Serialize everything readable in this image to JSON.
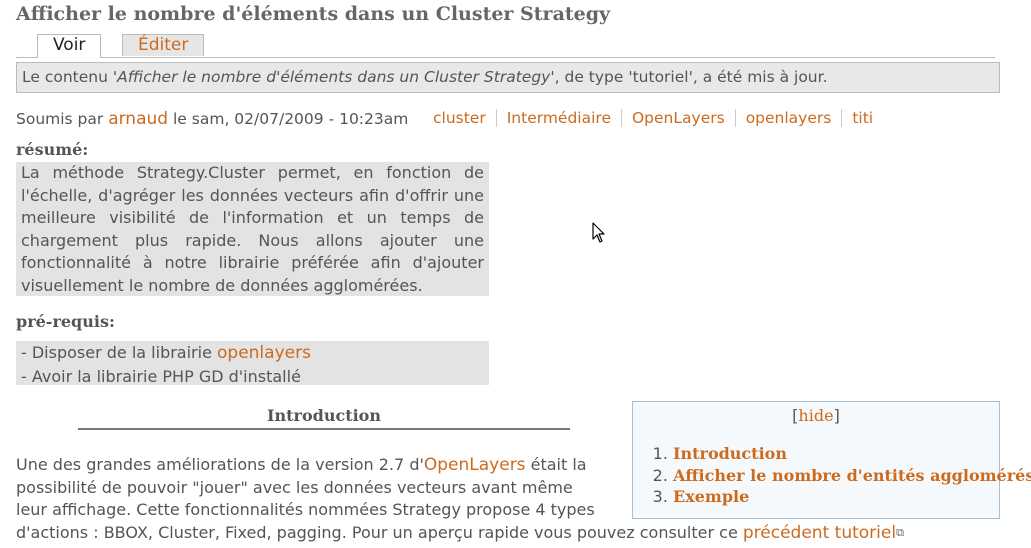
{
  "page": {
    "title": "Afficher le nombre d'éléments dans un Cluster Strategy"
  },
  "tabs": {
    "voir": "Voir",
    "editer": "Éditer"
  },
  "status": {
    "prefix": "Le contenu '",
    "title": "Afficher le nombre d'éléments dans un Cluster Strategy",
    "suffix": "', de type 'tutoriel', a été mis à jour."
  },
  "submitted": {
    "prefix": "Soumis par ",
    "author": "arnaud",
    "date": " le sam, 02/07/2009 - 10:23am"
  },
  "tags": [
    "cluster",
    "Intermédiaire",
    "OpenLayers",
    "openlayers",
    "titi"
  ],
  "resume": {
    "label": "résumé:",
    "text": "La méthode Strategy.Cluster permet, en fonction de l'échelle, d'agréger les données vecteurs afin d'offrir une meilleure visibilité de l'information et un temps de chargement plus rapide. Nous allons ajouter une fonctionnalité à notre librairie préférée afin d'ajouter visuellement le nombre de données agglomérées."
  },
  "prereq": {
    "label": "pré-requis:",
    "line1_prefix": "- Disposer de la librairie ",
    "line1_link": "openlayers",
    "line2": "- Avoir la librairie PHP GD d'installé"
  },
  "intro": {
    "heading": "Introduction"
  },
  "body": {
    "line1_prefix": "Une des grandes améliorations de la version 2.7 d'",
    "line1_link": "OpenLayers",
    "line1_suffix": " était la",
    "line2": "possibilité de pouvoir \"jouer\" avec les données vecteurs avant même",
    "line3": "leur affichage. Cette fonctionnalités nommées Strategy propose 4 types",
    "line4_prefix": "d'actions : BBOX, Cluster, Fixed, pagging. Pour un aperçu rapide vous pouvez consulter ce ",
    "line4_link": "précédent tutoriel"
  },
  "toc": {
    "hide_label": "hide",
    "items": [
      "Introduction",
      "Afficher le nombre d'entités agglomérés",
      "Exemple"
    ]
  },
  "icons": {
    "cursor": "mouse-pointer-icon",
    "external_link": "external-link-icon"
  },
  "colors": {
    "link": "#cc6a1e",
    "message_bg": "#e8e8e8",
    "box_bg": "#e3e3e3",
    "toc_border": "#a8c0d4"
  }
}
